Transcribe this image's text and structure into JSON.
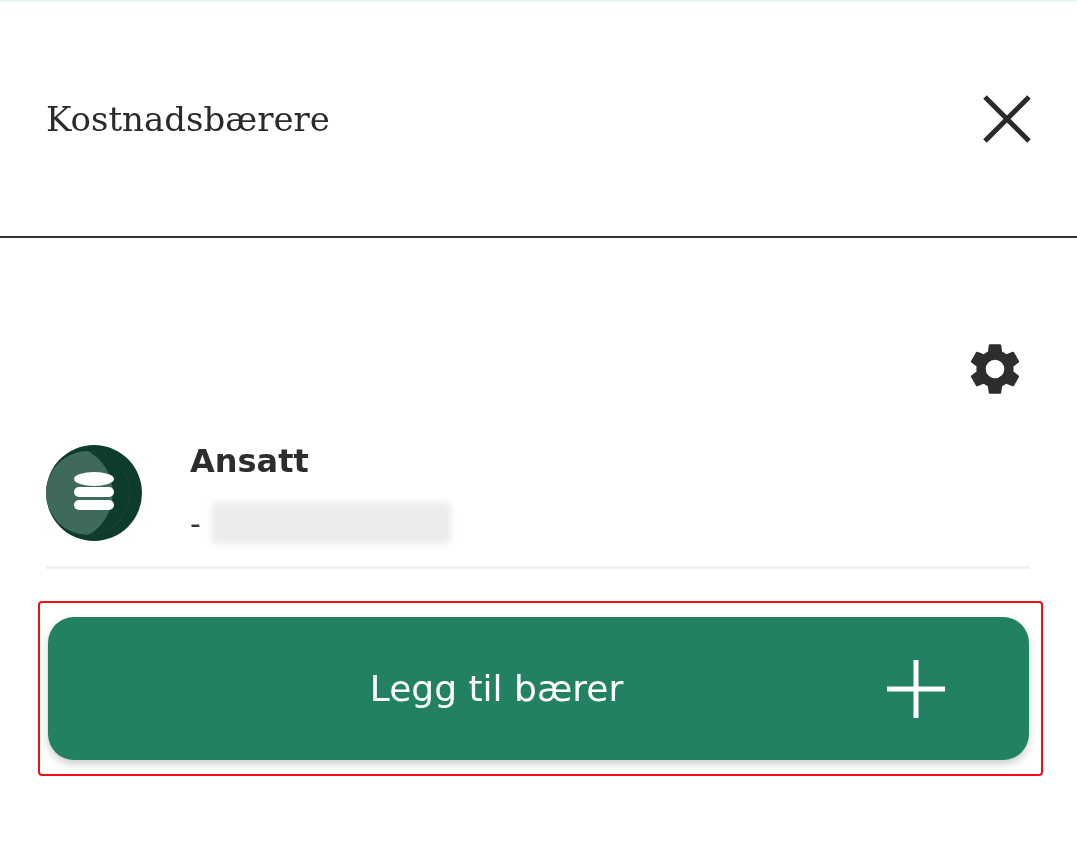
{
  "header": {
    "title": "Kostnadsbærere"
  },
  "carriers": [
    {
      "kind": "database",
      "name": "Ansatt",
      "prefix": "-",
      "detail_redacted": true
    }
  ],
  "add_button": {
    "label": "Legg til bærer",
    "highlighted": true
  }
}
